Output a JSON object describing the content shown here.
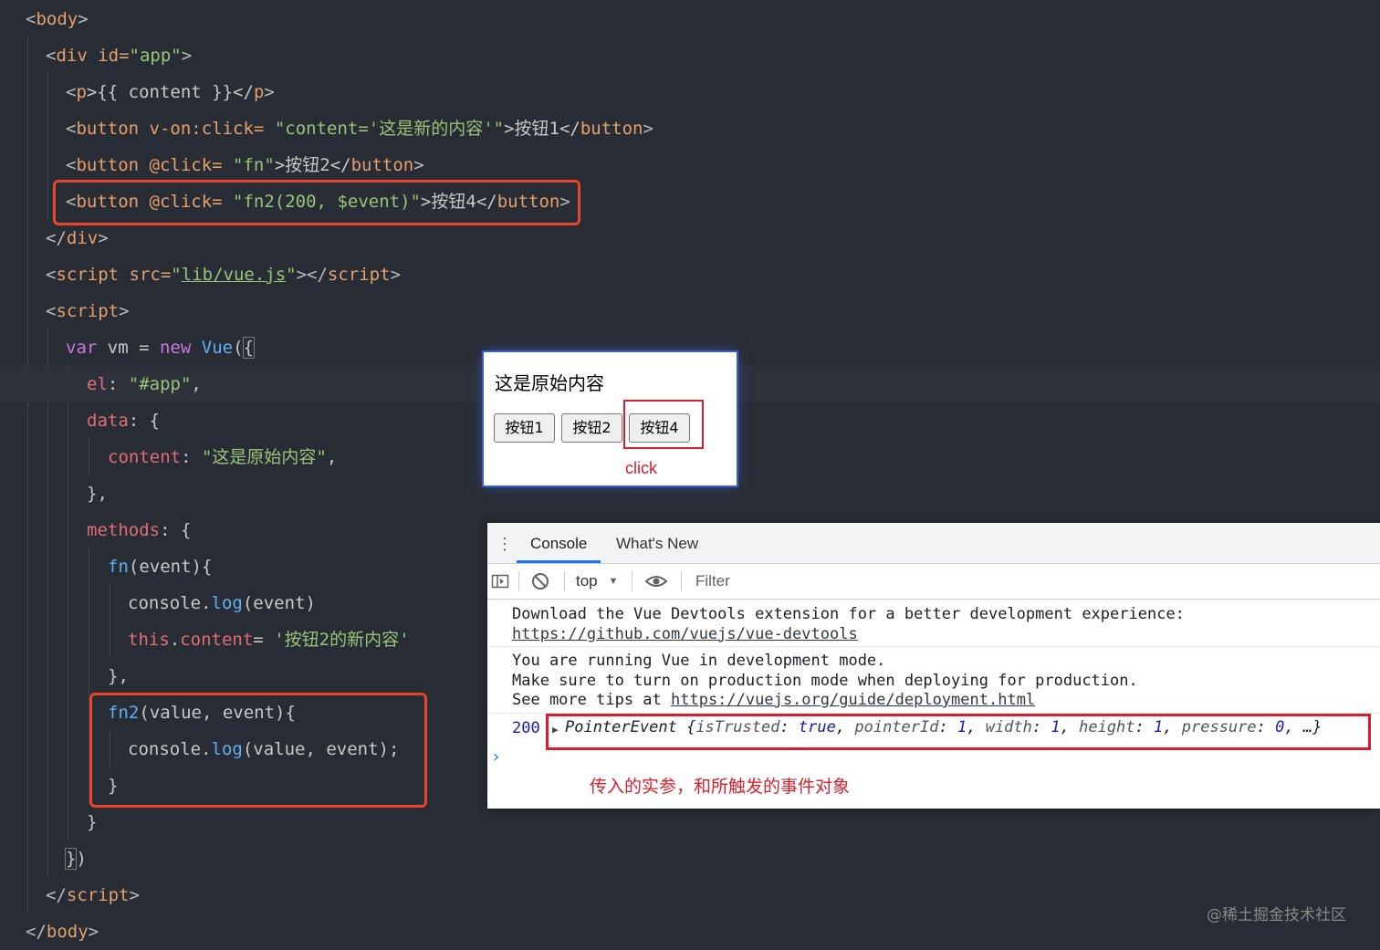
{
  "code": {
    "l1": [
      "<",
      "body",
      ">"
    ],
    "l2": [
      "<",
      "div",
      " id=",
      "\"app\"",
      ">"
    ],
    "l3": [
      "<",
      "p",
      ">{{ content }}</",
      "p",
      ">"
    ],
    "l4": [
      "<",
      "button",
      " v-on:click=",
      " \"content='这是新的内容'\"",
      ">按钮1</",
      "button",
      ">"
    ],
    "l5": [
      "<",
      "button",
      " @click=",
      " \"fn\"",
      ">按钮2</",
      "button",
      ">"
    ],
    "l6": [
      "<",
      "button",
      " @click=",
      " \"fn2(200, $event)\"",
      ">按钮4</",
      "button",
      ">"
    ],
    "l7": [
      "</",
      "div",
      ">"
    ],
    "l8": [
      "<",
      "script",
      " src=",
      "\"",
      "lib/vue.js",
      "\"",
      "></",
      "script",
      ">"
    ],
    "l9": [
      "<",
      "script",
      ">"
    ],
    "l10": [
      "var",
      " vm = ",
      "new",
      " ",
      "Vue",
      "(",
      "{"
    ],
    "l11": [
      "el",
      ": ",
      "\"#app\"",
      ","
    ],
    "l12": [
      "data",
      ": {"
    ],
    "l13": [
      "content",
      ": ",
      "\"这是原始内容\"",
      ","
    ],
    "l14": [
      "},"
    ],
    "l15": [
      "methods",
      ": {"
    ],
    "l16": [
      "fn",
      "(event){"
    ],
    "l17": [
      "console.",
      "log",
      "(event)"
    ],
    "l18": [
      "this",
      ".",
      "content",
      "= ",
      "'按钮2的新内容'"
    ],
    "l19": [
      "},"
    ],
    "l20": [
      "fn2",
      "(value, event){"
    ],
    "l21": [
      "console.",
      "log",
      "(value, event);"
    ],
    "l22": [
      "}"
    ],
    "l23": [
      "}"
    ],
    "l24": [
      "}",
      ")"
    ],
    "l25": [
      "</",
      "script",
      ">"
    ],
    "l26": [
      "</",
      "body",
      ">"
    ]
  },
  "preview": {
    "content_text": "这是原始内容",
    "buttons": [
      "按钮1",
      "按钮2",
      "按钮4"
    ],
    "annotation": "click"
  },
  "devtools": {
    "tabs": [
      "Console",
      "What's New"
    ],
    "context": "top",
    "filter_placeholder": "Filter",
    "messages": {
      "m1_line1": "Download the Vue Devtools extension for a better development experience:",
      "m1_link": "https://github.com/vuejs/vue-devtools",
      "m2_line1": "You are running Vue in development mode.",
      "m2_line2": "Make sure to turn on production mode when deploying for production.",
      "m2_line3_prefix": "See more tips at ",
      "m2_link": "https://vuejs.org/guide/deployment.html",
      "log_number": "200",
      "log_object": {
        "name": "PointerEvent",
        "open": " {",
        "k1": "isTrusted",
        "v1": "true",
        "k2": "pointerId",
        "v2": "1",
        "k3": "width",
        "v3": "1",
        "k4": "height",
        "v4": "1",
        "k5": "pressure",
        "v5": "0",
        "tail": "…}"
      }
    },
    "annotation": "传入的实参，和所触发的事件对象"
  },
  "watermark": "@稀土掘金技术社区",
  "colors": {
    "highlight_box": "#e8452c",
    "annotation_red": "#d6202f",
    "editor_bg": "#282c34"
  }
}
